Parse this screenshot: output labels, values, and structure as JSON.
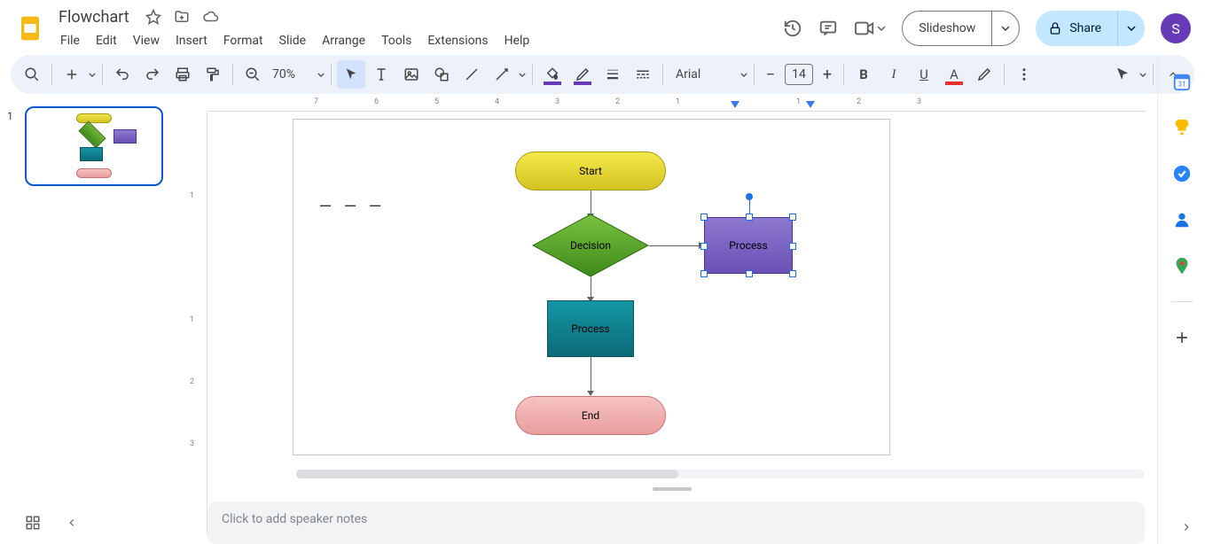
{
  "header": {
    "doc_title": "Flowchart",
    "avatar_initial": "S"
  },
  "menu": {
    "items": [
      "File",
      "Edit",
      "View",
      "Insert",
      "Format",
      "Slide",
      "Arrange",
      "Tools",
      "Extensions",
      "Help"
    ]
  },
  "actions": {
    "slideshow": "Slideshow",
    "share": "Share"
  },
  "toolbar": {
    "zoom": "70%",
    "font_family": "Arial",
    "font_size": "14",
    "fill_accent": "#673ab7",
    "border_accent": "#673ab7",
    "text_color_accent": "#000000"
  },
  "slides": {
    "current_number": "1"
  },
  "flowchart": {
    "start": "Start",
    "decision": "Decision",
    "process1": "Process",
    "process2": "Process",
    "end": "End"
  },
  "ruler_h": [
    "7",
    "6",
    "5",
    "4",
    "3",
    "2",
    "1",
    "",
    "1",
    "2",
    "3"
  ],
  "ruler_v": [
    "",
    "1",
    "",
    "1",
    "2",
    "3"
  ],
  "notes": {
    "placeholder": "Click to add speaker notes"
  }
}
